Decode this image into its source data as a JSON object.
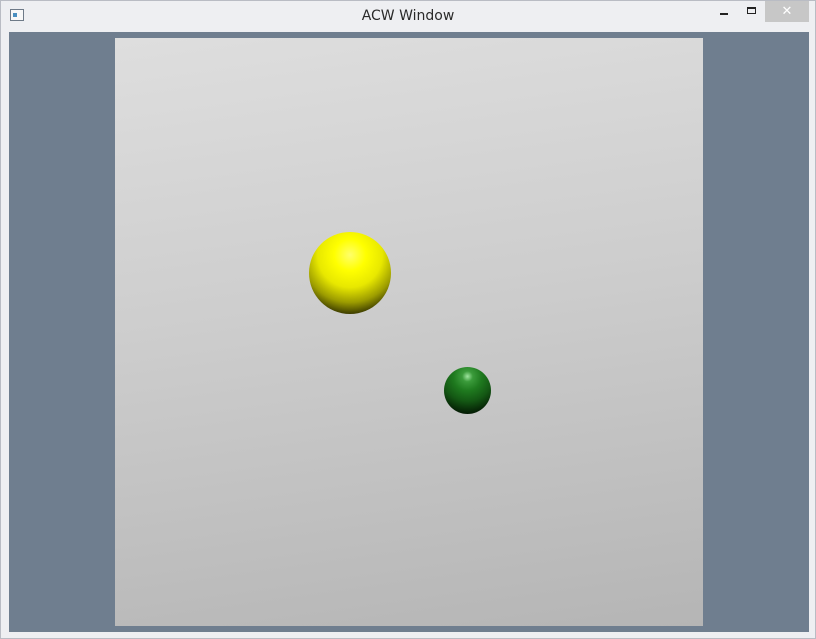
{
  "window": {
    "title": "ACW Window",
    "close_glyph": "✕",
    "icons": {
      "app": "app-window-icon",
      "minimize": "minimize-icon",
      "maximize": "maximize-icon",
      "close": "close-icon"
    }
  },
  "colors": {
    "client_background": "#6f7e8f",
    "viewport_top": "#dedede",
    "viewport_bottom": "#b5b5b5",
    "ball_yellow": "#ffff00",
    "ball_green": "#1f7a1f"
  }
}
